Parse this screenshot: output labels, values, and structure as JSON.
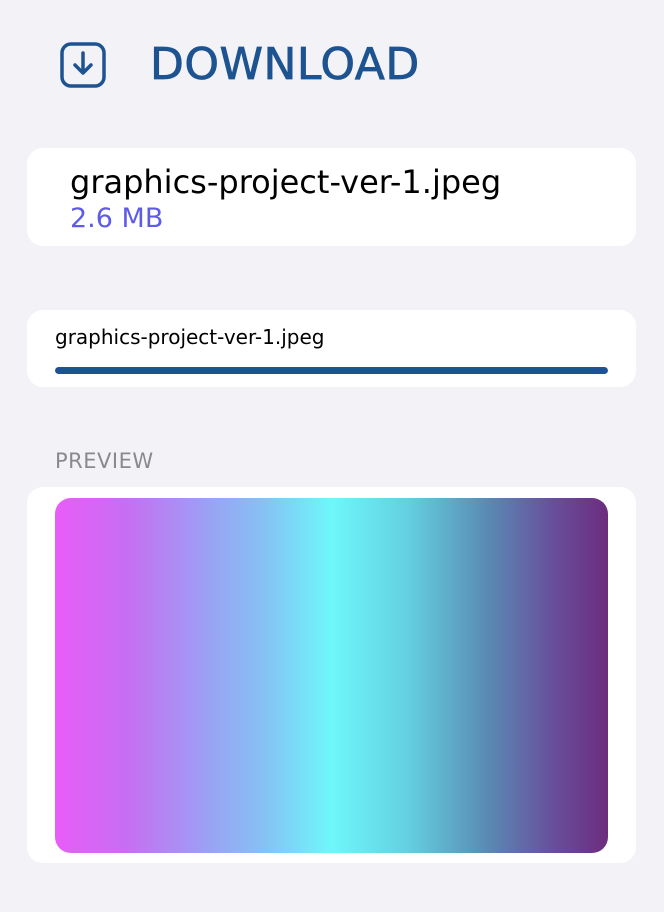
{
  "header": {
    "title": "DOWNLOAD",
    "icon": "download-icon"
  },
  "file": {
    "name": "graphics-project-ver-1.jpeg",
    "size": "2.6 MB"
  },
  "progress": {
    "label": "graphics-project-ver-1.jpeg",
    "fraction": 1.0
  },
  "preview": {
    "section_label": "PREVIEW"
  },
  "colors": {
    "accent": "#1e5391",
    "size_text": "#5e5ce6",
    "background": "#f2f2f7"
  }
}
